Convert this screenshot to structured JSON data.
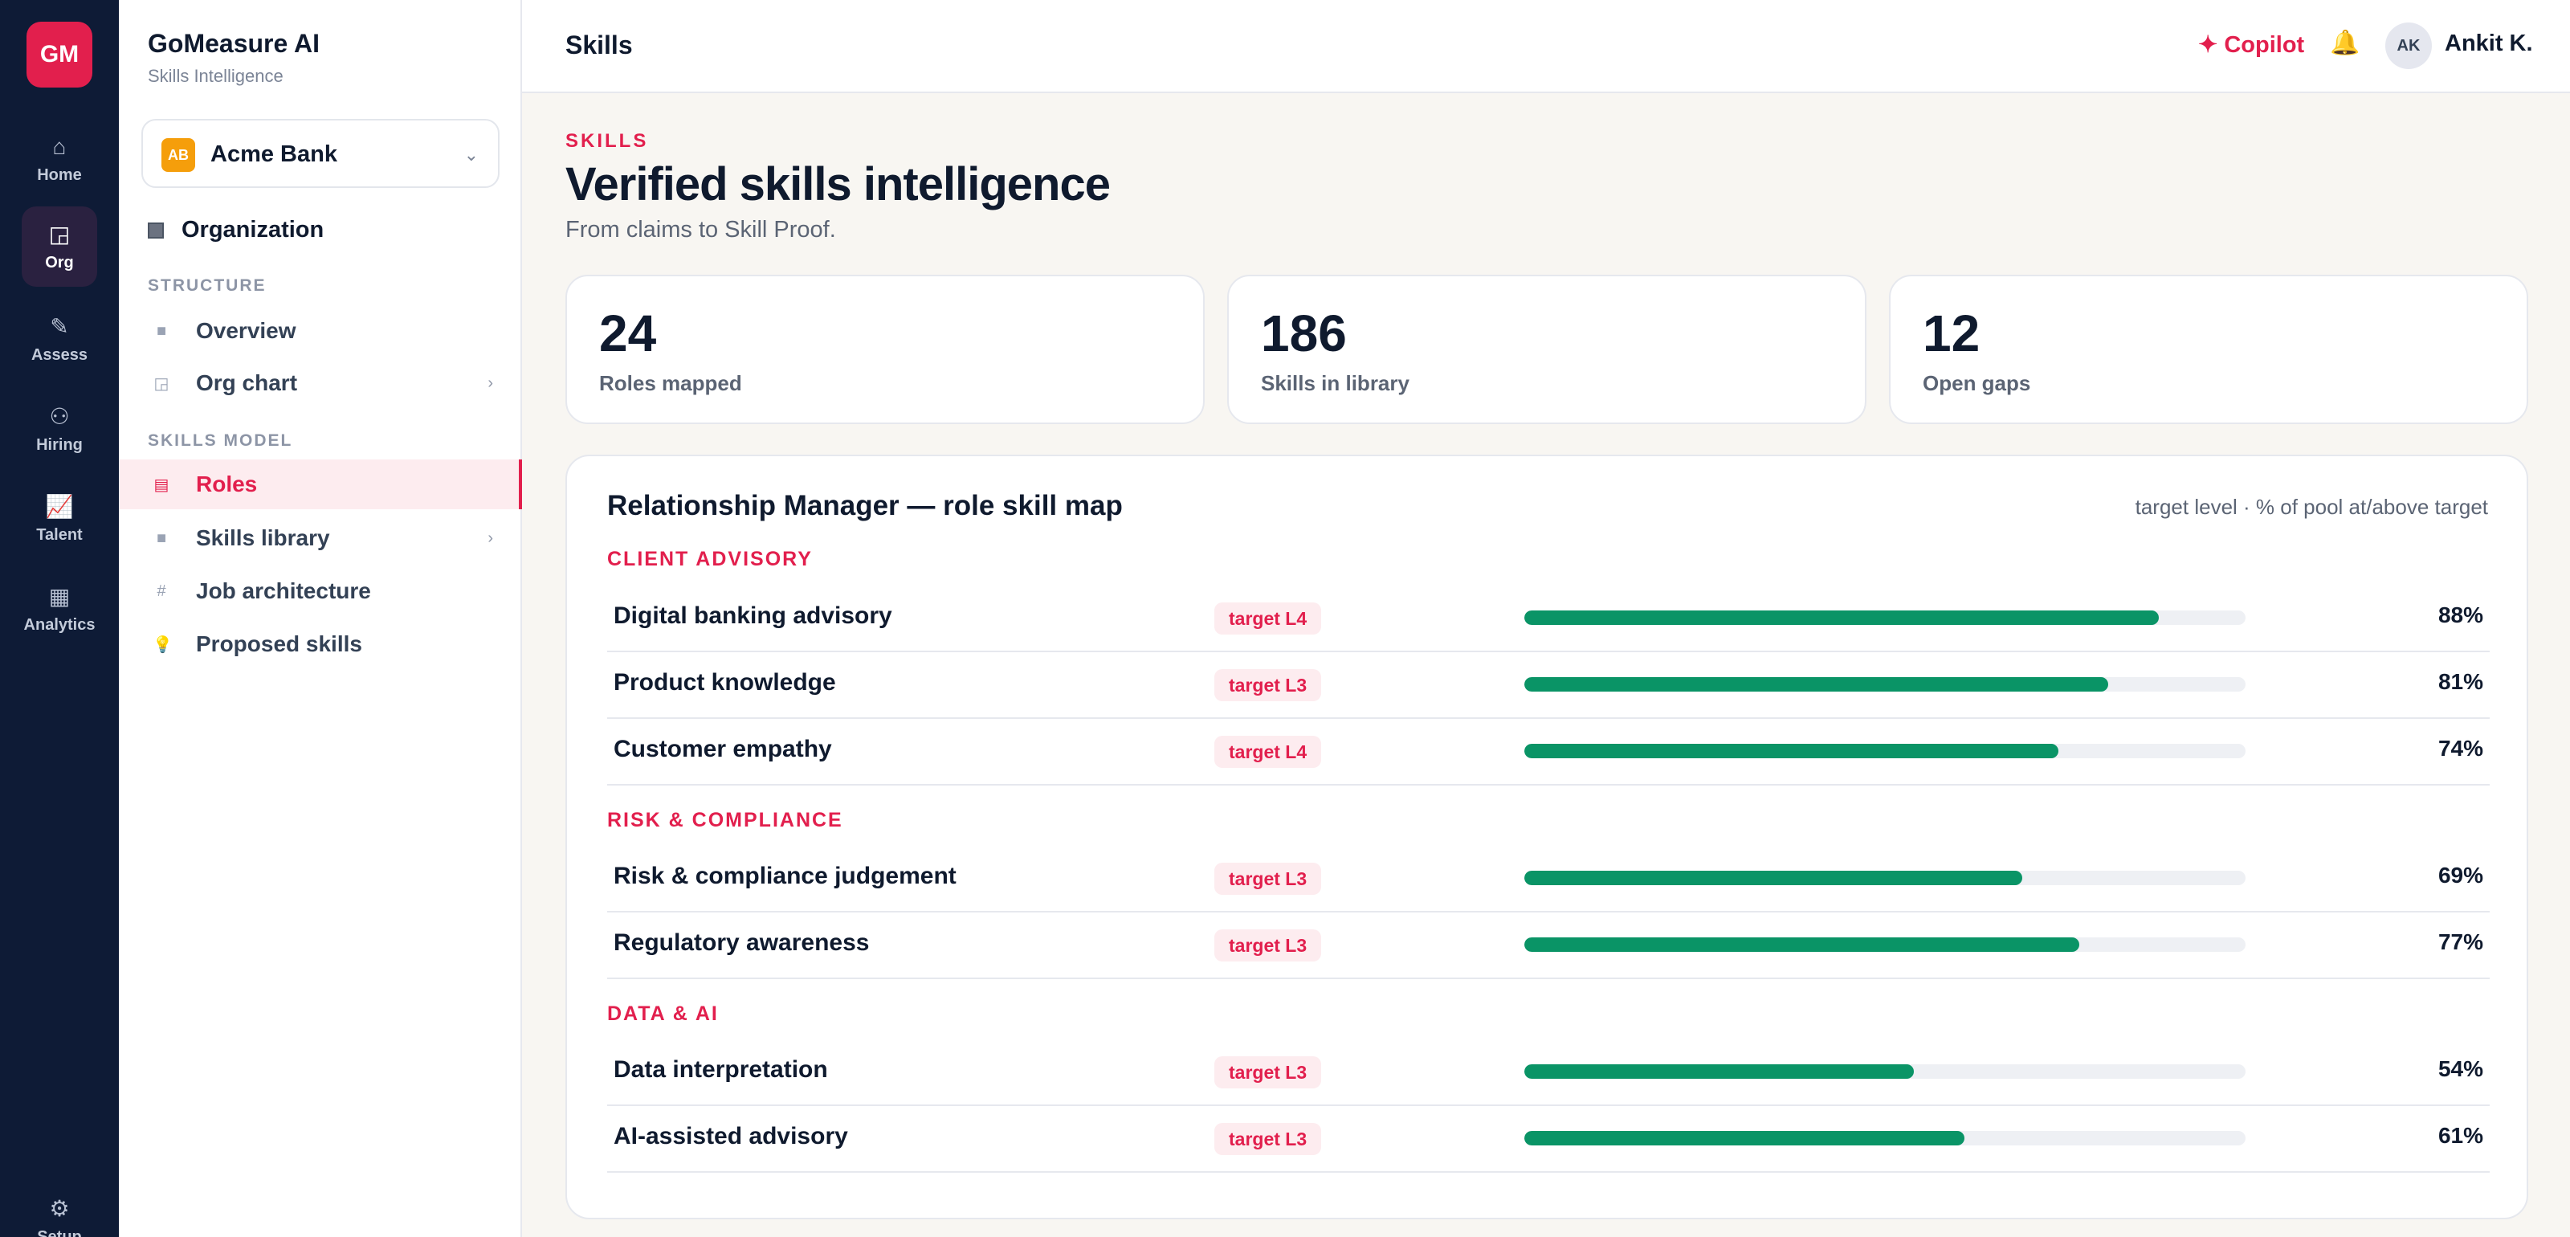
{
  "rail": {
    "logo": "GM",
    "items": [
      {
        "icon": "home-icon",
        "glyph": "⌂",
        "label": "Home"
      },
      {
        "icon": "org-icon",
        "glyph": "◲",
        "label": "Org"
      },
      {
        "icon": "pencil-icon",
        "glyph": "✎",
        "label": "Assess"
      },
      {
        "icon": "people-icon",
        "glyph": "⚇",
        "label": "Hiring"
      },
      {
        "icon": "chart-icon",
        "glyph": "📈",
        "label": "Talent"
      },
      {
        "icon": "grid-icon",
        "glyph": "▦",
        "label": "Analytics"
      }
    ],
    "setup": {
      "icon": "gear-icon",
      "glyph": "⚙",
      "label": "Setup"
    }
  },
  "sidebar": {
    "app_name": "GoMeasure AI",
    "app_sub": "Skills Intelligence",
    "org_select": {
      "badge": "AB",
      "name": "Acme Bank",
      "chevron": "⌄"
    },
    "org_heading": "Organization",
    "structure_label": "STRUCTURE",
    "structure_items": [
      {
        "icon": "square-icon",
        "glyph": "■",
        "label": "Overview"
      },
      {
        "icon": "org-chart-icon",
        "glyph": "◲",
        "label": "Org chart",
        "chevron": "›"
      }
    ],
    "model_label": "SKILLS MODEL",
    "model_items": [
      {
        "icon": "roles-icon",
        "glyph": "▤",
        "label": "Roles"
      },
      {
        "icon": "library-icon",
        "glyph": "■",
        "label": "Skills library",
        "chevron": "›"
      },
      {
        "icon": "hash-icon",
        "glyph": "#",
        "label": "Job architecture"
      },
      {
        "icon": "bulb-icon",
        "glyph": "💡",
        "label": "Proposed skills"
      }
    ]
  },
  "header": {
    "title": "Skills",
    "copilot": "✦ Copilot",
    "bell": "🔔",
    "avatar": "AK",
    "user": "Ankit K."
  },
  "main": {
    "kicker": "SKILLS",
    "title": "Verified skills intelligence",
    "subtitle": "From claims to Skill Proof.",
    "stats": [
      {
        "value": "24",
        "label": "Roles mapped"
      },
      {
        "value": "186",
        "label": "Skills in library"
      },
      {
        "value": "12",
        "label": "Open gaps"
      }
    ],
    "card": {
      "title": "Relationship Manager — role skill map",
      "legend": "target level · % of pool at/above target",
      "groups": [
        {
          "label": "CLIENT ADVISORY",
          "skills": [
            {
              "name": "Digital banking advisory",
              "target": "target L4",
              "pct": "88%",
              "value": 88
            },
            {
              "name": "Product knowledge",
              "target": "target L3",
              "pct": "81%",
              "value": 81
            },
            {
              "name": "Customer empathy",
              "target": "target L4",
              "pct": "74%",
              "value": 74
            }
          ]
        },
        {
          "label": "RISK & COMPLIANCE",
          "skills": [
            {
              "name": "Risk & compliance judgement",
              "target": "target L3",
              "pct": "69%",
              "value": 69
            },
            {
              "name": "Regulatory awareness",
              "target": "target L3",
              "pct": "77%",
              "value": 77
            }
          ]
        },
        {
          "label": "DATA & AI",
          "skills": [
            {
              "name": "Data interpretation",
              "target": "target L3",
              "pct": "54%",
              "value": 54
            },
            {
              "name": "AI-assisted advisory",
              "target": "target L3",
              "pct": "61%",
              "value": 61
            }
          ]
        }
      ]
    }
  },
  "colors": {
    "accent": "#e21f4d",
    "rail": "#0e1b36",
    "bar": "#0a9466",
    "org_badge": "#f59e0b"
  }
}
